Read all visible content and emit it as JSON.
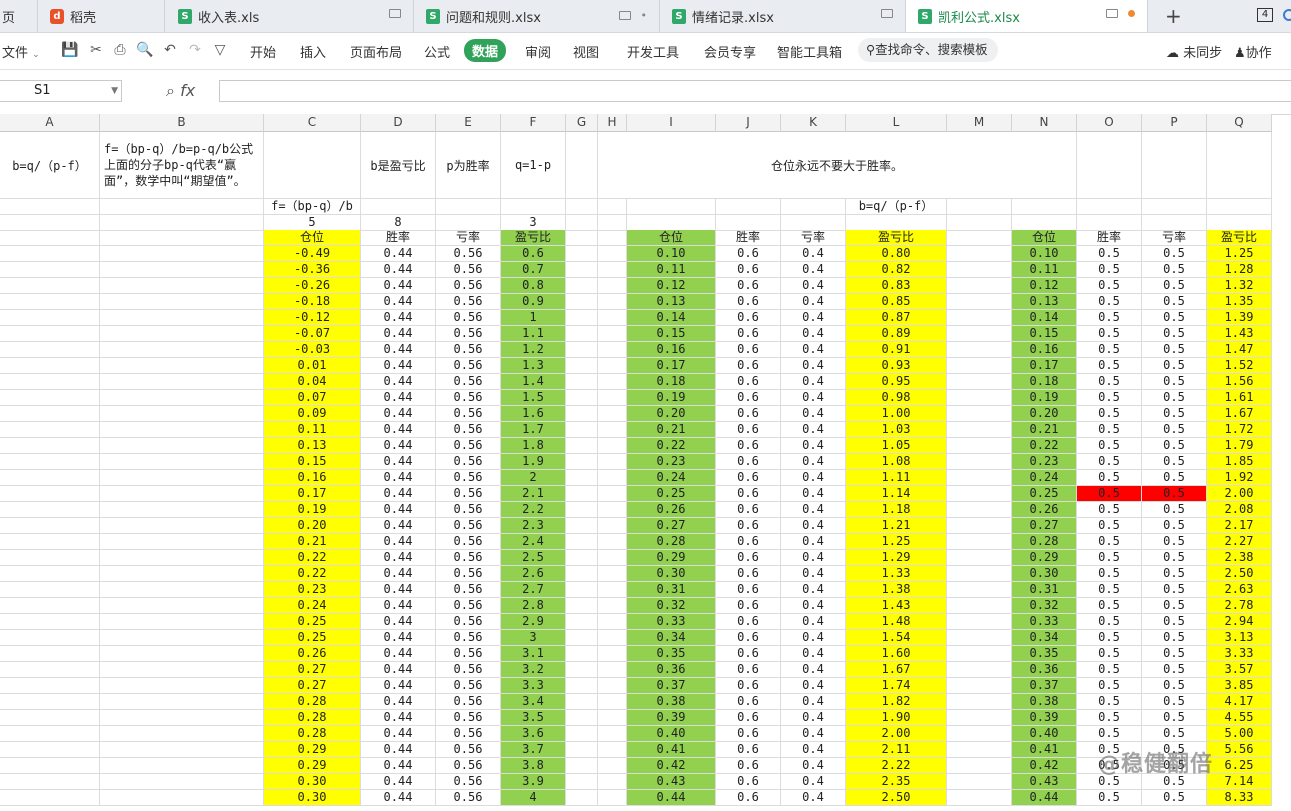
{
  "tabs": [
    {
      "label": "页",
      "icon": "",
      "active": false
    },
    {
      "label": "稻壳",
      "icon": "docer-icon",
      "active": false
    },
    {
      "label": "收入表.xls",
      "icon": "sheet-icon",
      "active": false
    },
    {
      "label": "问题和规则.xlsx",
      "icon": "sheet-icon",
      "active": false
    },
    {
      "label": "情绪记录.xlsx",
      "icon": "sheet-icon",
      "active": false
    },
    {
      "label": "凯利公式.xlsx",
      "icon": "sheet-icon",
      "active": true
    }
  ],
  "tab_count": "4",
  "toolbar": {
    "file": "文件",
    "menus": [
      "开始",
      "插入",
      "页面布局",
      "公式",
      "数据",
      "审阅",
      "视图",
      "开发工具",
      "会员专享",
      "智能工具箱"
    ],
    "active_menu": "数据",
    "search": "查找命令、搜索模板",
    "sync": "未同步",
    "collab": "协作"
  },
  "formula_bar": {
    "name_box": "S1",
    "fx": "fx",
    "content": ""
  },
  "columns": [
    "A",
    "B",
    "C",
    "D",
    "E",
    "F",
    "G",
    "H",
    "I",
    "J",
    "K",
    "L",
    "M",
    "N",
    "O",
    "P",
    "Q"
  ],
  "header_texts": {
    "a1": "b=q/（p-f）",
    "b1": "f=（bp-q）/b=p-q/b公式上面的分子bp-q代表“赢面”，数学中叫“期望值”。",
    "d1": "b是盈亏比",
    "e1": "p为胜率",
    "f1": "q=1-p",
    "merged1": "仓位永远不要大于胜率。",
    "c2": "f=（bp-q）/b",
    "l2": "b=q/（p-f）",
    "c3": "5",
    "d3": "8",
    "f3": "3"
  },
  "table_headers": {
    "left": [
      "仓位",
      "胜率",
      "亏率",
      "盈亏比"
    ],
    "mid": [
      "仓位",
      "胜率",
      "亏率",
      "盈亏比"
    ],
    "right": [
      "仓位",
      "胜率",
      "亏率",
      "盈亏比"
    ]
  },
  "rows_left": [
    [
      "-0.49",
      "0.44",
      "0.56",
      "0.6"
    ],
    [
      "-0.36",
      "0.44",
      "0.56",
      "0.7"
    ],
    [
      "-0.26",
      "0.44",
      "0.56",
      "0.8"
    ],
    [
      "-0.18",
      "0.44",
      "0.56",
      "0.9"
    ],
    [
      "-0.12",
      "0.44",
      "0.56",
      "1"
    ],
    [
      "-0.07",
      "0.44",
      "0.56",
      "1.1"
    ],
    [
      "-0.03",
      "0.44",
      "0.56",
      "1.2"
    ],
    [
      "0.01",
      "0.44",
      "0.56",
      "1.3"
    ],
    [
      "0.04",
      "0.44",
      "0.56",
      "1.4"
    ],
    [
      "0.07",
      "0.44",
      "0.56",
      "1.5"
    ],
    [
      "0.09",
      "0.44",
      "0.56",
      "1.6"
    ],
    [
      "0.11",
      "0.44",
      "0.56",
      "1.7"
    ],
    [
      "0.13",
      "0.44",
      "0.56",
      "1.8"
    ],
    [
      "0.15",
      "0.44",
      "0.56",
      "1.9"
    ],
    [
      "0.16",
      "0.44",
      "0.56",
      "2"
    ],
    [
      "0.17",
      "0.44",
      "0.56",
      "2.1"
    ],
    [
      "0.19",
      "0.44",
      "0.56",
      "2.2"
    ],
    [
      "0.20",
      "0.44",
      "0.56",
      "2.3"
    ],
    [
      "0.21",
      "0.44",
      "0.56",
      "2.4"
    ],
    [
      "0.22",
      "0.44",
      "0.56",
      "2.5"
    ],
    [
      "0.22",
      "0.44",
      "0.56",
      "2.6"
    ],
    [
      "0.23",
      "0.44",
      "0.56",
      "2.7"
    ],
    [
      "0.24",
      "0.44",
      "0.56",
      "2.8"
    ],
    [
      "0.25",
      "0.44",
      "0.56",
      "2.9"
    ],
    [
      "0.25",
      "0.44",
      "0.56",
      "3"
    ],
    [
      "0.26",
      "0.44",
      "0.56",
      "3.1"
    ],
    [
      "0.27",
      "0.44",
      "0.56",
      "3.2"
    ],
    [
      "0.27",
      "0.44",
      "0.56",
      "3.3"
    ],
    [
      "0.28",
      "0.44",
      "0.56",
      "3.4"
    ],
    [
      "0.28",
      "0.44",
      "0.56",
      "3.5"
    ],
    [
      "0.28",
      "0.44",
      "0.56",
      "3.6"
    ],
    [
      "0.29",
      "0.44",
      "0.56",
      "3.7"
    ],
    [
      "0.29",
      "0.44",
      "0.56",
      "3.8"
    ],
    [
      "0.30",
      "0.44",
      "0.56",
      "3.9"
    ],
    [
      "0.30",
      "0.44",
      "0.56",
      "4"
    ]
  ],
  "rows_mid": [
    [
      "0.10",
      "0.6",
      "0.4",
      "0.80"
    ],
    [
      "0.11",
      "0.6",
      "0.4",
      "0.82"
    ],
    [
      "0.12",
      "0.6",
      "0.4",
      "0.83"
    ],
    [
      "0.13",
      "0.6",
      "0.4",
      "0.85"
    ],
    [
      "0.14",
      "0.6",
      "0.4",
      "0.87"
    ],
    [
      "0.15",
      "0.6",
      "0.4",
      "0.89"
    ],
    [
      "0.16",
      "0.6",
      "0.4",
      "0.91"
    ],
    [
      "0.17",
      "0.6",
      "0.4",
      "0.93"
    ],
    [
      "0.18",
      "0.6",
      "0.4",
      "0.95"
    ],
    [
      "0.19",
      "0.6",
      "0.4",
      "0.98"
    ],
    [
      "0.20",
      "0.6",
      "0.4",
      "1.00"
    ],
    [
      "0.21",
      "0.6",
      "0.4",
      "1.03"
    ],
    [
      "0.22",
      "0.6",
      "0.4",
      "1.05"
    ],
    [
      "0.23",
      "0.6",
      "0.4",
      "1.08"
    ],
    [
      "0.24",
      "0.6",
      "0.4",
      "1.11"
    ],
    [
      "0.25",
      "0.6",
      "0.4",
      "1.14"
    ],
    [
      "0.26",
      "0.6",
      "0.4",
      "1.18"
    ],
    [
      "0.27",
      "0.6",
      "0.4",
      "1.21"
    ],
    [
      "0.28",
      "0.6",
      "0.4",
      "1.25"
    ],
    [
      "0.29",
      "0.6",
      "0.4",
      "1.29"
    ],
    [
      "0.30",
      "0.6",
      "0.4",
      "1.33"
    ],
    [
      "0.31",
      "0.6",
      "0.4",
      "1.38"
    ],
    [
      "0.32",
      "0.6",
      "0.4",
      "1.43"
    ],
    [
      "0.33",
      "0.6",
      "0.4",
      "1.48"
    ],
    [
      "0.34",
      "0.6",
      "0.4",
      "1.54"
    ],
    [
      "0.35",
      "0.6",
      "0.4",
      "1.60"
    ],
    [
      "0.36",
      "0.6",
      "0.4",
      "1.67"
    ],
    [
      "0.37",
      "0.6",
      "0.4",
      "1.74"
    ],
    [
      "0.38",
      "0.6",
      "0.4",
      "1.82"
    ],
    [
      "0.39",
      "0.6",
      "0.4",
      "1.90"
    ],
    [
      "0.40",
      "0.6",
      "0.4",
      "2.00"
    ],
    [
      "0.41",
      "0.6",
      "0.4",
      "2.11"
    ],
    [
      "0.42",
      "0.6",
      "0.4",
      "2.22"
    ],
    [
      "0.43",
      "0.6",
      "0.4",
      "2.35"
    ],
    [
      "0.44",
      "0.6",
      "0.4",
      "2.50"
    ]
  ],
  "rows_right": [
    [
      "0.10",
      "0.5",
      "0.5",
      "1.25"
    ],
    [
      "0.11",
      "0.5",
      "0.5",
      "1.28"
    ],
    [
      "0.12",
      "0.5",
      "0.5",
      "1.32"
    ],
    [
      "0.13",
      "0.5",
      "0.5",
      "1.35"
    ],
    [
      "0.14",
      "0.5",
      "0.5",
      "1.39"
    ],
    [
      "0.15",
      "0.5",
      "0.5",
      "1.43"
    ],
    [
      "0.16",
      "0.5",
      "0.5",
      "1.47"
    ],
    [
      "0.17",
      "0.5",
      "0.5",
      "1.52"
    ],
    [
      "0.18",
      "0.5",
      "0.5",
      "1.56"
    ],
    [
      "0.19",
      "0.5",
      "0.5",
      "1.61"
    ],
    [
      "0.20",
      "0.5",
      "0.5",
      "1.67"
    ],
    [
      "0.21",
      "0.5",
      "0.5",
      "1.72"
    ],
    [
      "0.22",
      "0.5",
      "0.5",
      "1.79"
    ],
    [
      "0.23",
      "0.5",
      "0.5",
      "1.85"
    ],
    [
      "0.24",
      "0.5",
      "0.5",
      "1.92"
    ],
    [
      "0.25",
      "0.5",
      "0.5",
      "2.00"
    ],
    [
      "0.26",
      "0.5",
      "0.5",
      "2.08"
    ],
    [
      "0.27",
      "0.5",
      "0.5",
      "2.17"
    ],
    [
      "0.28",
      "0.5",
      "0.5",
      "2.27"
    ],
    [
      "0.29",
      "0.5",
      "0.5",
      "2.38"
    ],
    [
      "0.30",
      "0.5",
      "0.5",
      "2.50"
    ],
    [
      "0.31",
      "0.5",
      "0.5",
      "2.63"
    ],
    [
      "0.32",
      "0.5",
      "0.5",
      "2.78"
    ],
    [
      "0.33",
      "0.5",
      "0.5",
      "2.94"
    ],
    [
      "0.34",
      "0.5",
      "0.5",
      "3.13"
    ],
    [
      "0.35",
      "0.5",
      "0.5",
      "3.33"
    ],
    [
      "0.36",
      "0.5",
      "0.5",
      "3.57"
    ],
    [
      "0.37",
      "0.5",
      "0.5",
      "3.85"
    ],
    [
      "0.38",
      "0.5",
      "0.5",
      "4.17"
    ],
    [
      "0.39",
      "0.5",
      "0.5",
      "4.55"
    ],
    [
      "0.40",
      "0.5",
      "0.5",
      "5.00"
    ],
    [
      "0.41",
      "0.5",
      "0.5",
      "5.56"
    ],
    [
      "0.42",
      "0.5",
      "0.5",
      "6.25"
    ],
    [
      "0.43",
      "0.5",
      "0.5",
      "7.14"
    ],
    [
      "0.44",
      "0.5",
      "0.5",
      "8.33"
    ]
  ],
  "highlight_row_right": 15,
  "colors": {
    "yellow": "#ffff00",
    "green": "#92d050",
    "red": "#ff0000",
    "accent": "#30a25a"
  },
  "watermark": "@稳健翻倍"
}
